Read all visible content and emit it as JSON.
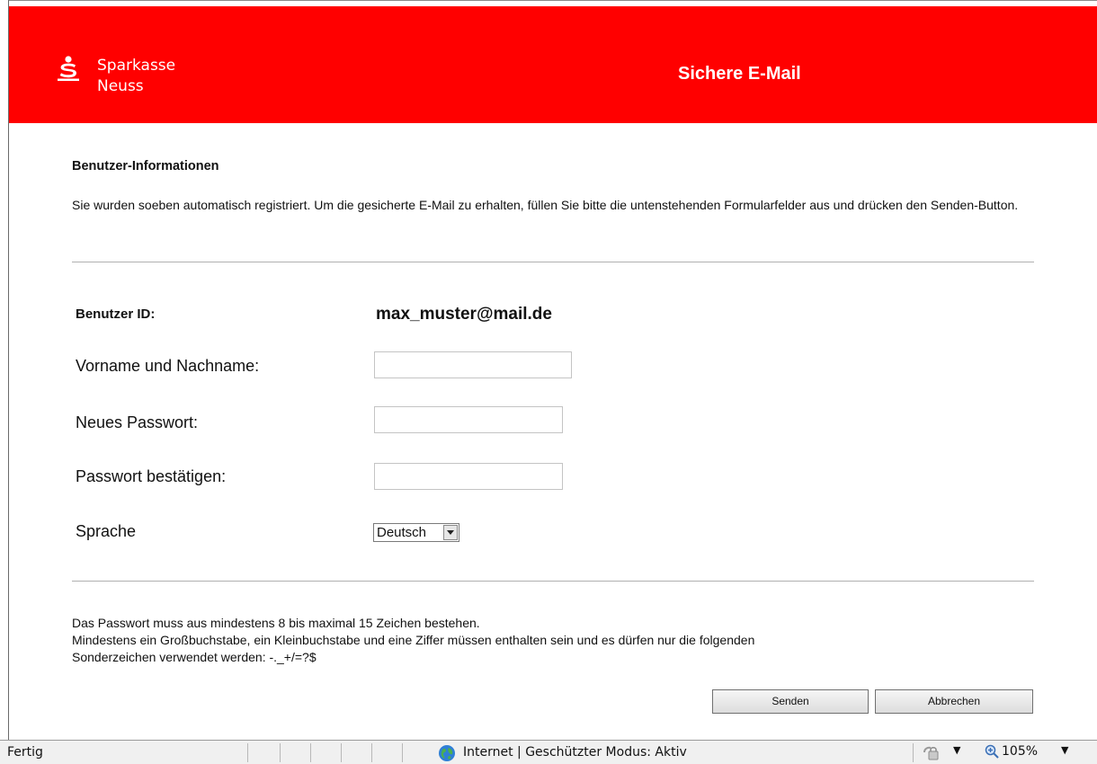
{
  "header": {
    "brand_line1": "Sparkasse",
    "brand_line2": "Neuss",
    "title": "Sichere E-Mail",
    "brand_color": "#ff0000"
  },
  "section": {
    "title": "Benutzer-Informationen",
    "intro": "Sie wurden soeben automatisch registriert. Um die gesicherte E-Mail zu erhalten, füllen Sie bitte die untenstehenden Formularfelder aus und drücken den Senden-Button."
  },
  "form": {
    "user_id_label": "Benutzer ID:",
    "user_id_value": "max_muster@mail.de",
    "name_label": "Vorname und Nachname:",
    "name_value": "",
    "password_label": "Neues Passwort:",
    "password_value": "",
    "confirm_label": "Passwort bestätigen:",
    "confirm_value": "",
    "language_label": "Sprache",
    "language_value": "Deutsch"
  },
  "notes": {
    "line1": "Das Passwort muss aus mindestens 8 bis maximal 15 Zeichen bestehen.",
    "line2": "Mindestens ein Großbuchstabe, ein Kleinbuchstabe und eine Ziffer müssen enthalten sein und es dürfen nur die folgenden",
    "line3": "Sonderzeichen verwendet werden: -._+/=?$"
  },
  "buttons": {
    "send": "Senden",
    "cancel": "Abbrechen"
  },
  "statusbar": {
    "status": "Fertig",
    "zone": "Internet | Geschützter Modus: Aktiv",
    "zoom": "105%",
    "zone_icon": "globe-icon",
    "security_icon": "lock-icon",
    "zoom_icon": "magnifier-icon"
  }
}
